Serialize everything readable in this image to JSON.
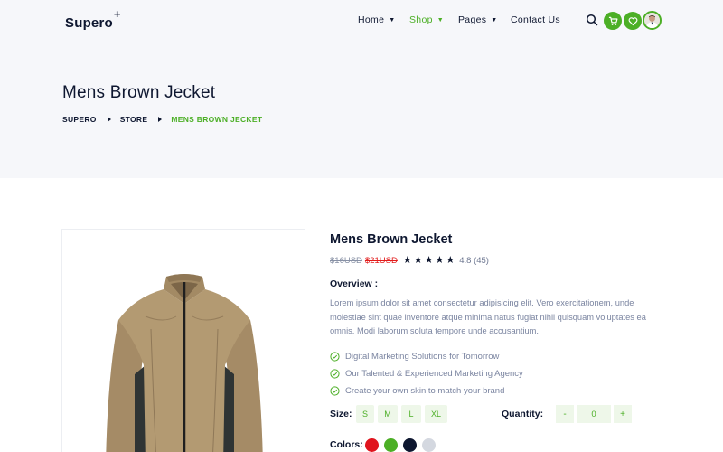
{
  "brand": {
    "logo_text": "Supero",
    "logo_mark": "+"
  },
  "nav": {
    "home": "Home",
    "shop": "Shop",
    "pages": "Pages",
    "contact": "Contact Us"
  },
  "header_icons": [
    "search-icon",
    "cart-icon",
    "heart-icon",
    "user-avatar"
  ],
  "page": {
    "title": "Mens Brown Jecket",
    "breadcrumb": [
      "SUPERO",
      "STORE",
      "MENS BROWN JECKET"
    ]
  },
  "product": {
    "title": "Mens Brown Jecket",
    "price": "$16USD",
    "old_price": "$21USD",
    "stars": 5,
    "rating": "4.8 (45)",
    "overview_title": "Overview :",
    "overview_text": "Lorem ipsum dolor sit amet consectetur adipisicing elit. Vero exercitationem, unde molestiae sint quae inventore atque minima natus fugiat nihil quisquam voluptates ea omnis. Modi laborum soluta tempore unde accusantium.",
    "features": [
      "Digital Marketing Solutions for Tomorrow",
      "Our Talented & Experienced Marketing Agency",
      "Create your own skin to match your brand"
    ],
    "size_label": "Size:",
    "sizes": [
      "S",
      "M",
      "L",
      "XL"
    ],
    "quantity_label": "Quantity:",
    "quantity_minus": "-",
    "quantity_value": "0",
    "quantity_plus": "+",
    "colors_label": "Colors:",
    "colors": [
      "#e0141e",
      "#4caf26",
      "#0e1730",
      "#d4d8e0"
    ]
  },
  "theme": {
    "accent": "#4caf26",
    "text": "#0e1730",
    "muted": "#7a84a0",
    "header_bg": "#f6f7fa"
  }
}
